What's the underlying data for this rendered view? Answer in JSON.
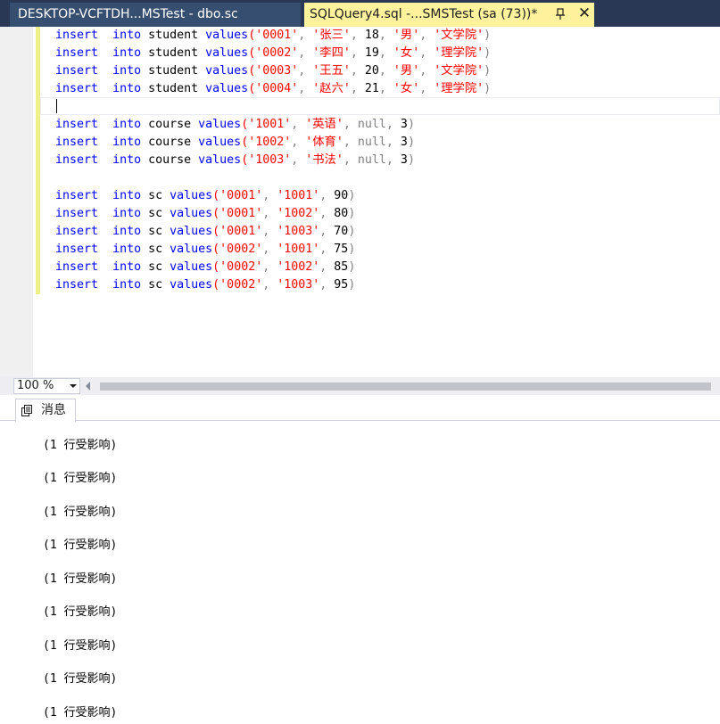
{
  "tabs": {
    "inactive_label": "DESKTOP-VCFTDH...MSTest - dbo.sc",
    "active_label": "SQLQuery4.sql -...SMSTest (sa (73))*",
    "close_glyph": "✕"
  },
  "code": {
    "lines": [
      [
        [
          "kw",
          "insert"
        ],
        [
          "",
          "  "
        ],
        [
          "kw",
          "into"
        ],
        [
          "",
          " student "
        ],
        [
          "kw",
          "values"
        ],
        [
          "str",
          "('0001'"
        ],
        [
          "gry",
          ", "
        ],
        [
          "str",
          "'张三'"
        ],
        [
          "gry",
          ", "
        ],
        [
          "",
          "18"
        ],
        [
          "gry",
          ", "
        ],
        [
          "str",
          "'男'"
        ],
        [
          "gry",
          ", "
        ],
        [
          "str",
          "'文学院'"
        ],
        [
          "gry",
          ")"
        ]
      ],
      [
        [
          "kw",
          "insert"
        ],
        [
          "",
          "  "
        ],
        [
          "kw",
          "into"
        ],
        [
          "",
          " student "
        ],
        [
          "kw",
          "values"
        ],
        [
          "str",
          "('0002'"
        ],
        [
          "gry",
          ", "
        ],
        [
          "str",
          "'李四'"
        ],
        [
          "gry",
          ", "
        ],
        [
          "",
          "19"
        ],
        [
          "gry",
          ", "
        ],
        [
          "str",
          "'女'"
        ],
        [
          "gry",
          ", "
        ],
        [
          "str",
          "'理学院'"
        ],
        [
          "gry",
          ")"
        ]
      ],
      [
        [
          "kw",
          "insert"
        ],
        [
          "",
          "  "
        ],
        [
          "kw",
          "into"
        ],
        [
          "",
          " student "
        ],
        [
          "kw",
          "values"
        ],
        [
          "str",
          "('0003'"
        ],
        [
          "gry",
          ", "
        ],
        [
          "str",
          "'王五'"
        ],
        [
          "gry",
          ", "
        ],
        [
          "",
          "20"
        ],
        [
          "gry",
          ", "
        ],
        [
          "str",
          "'男'"
        ],
        [
          "gry",
          ", "
        ],
        [
          "str",
          "'文学院'"
        ],
        [
          "gry",
          ")"
        ]
      ],
      [
        [
          "kw",
          "insert"
        ],
        [
          "",
          "  "
        ],
        [
          "kw",
          "into"
        ],
        [
          "",
          " student "
        ],
        [
          "kw",
          "values"
        ],
        [
          "str",
          "('0004'"
        ],
        [
          "gry",
          ", "
        ],
        [
          "str",
          "'赵六'"
        ],
        [
          "gry",
          ", "
        ],
        [
          "",
          "21"
        ],
        [
          "gry",
          ", "
        ],
        [
          "str",
          "'女'"
        ],
        [
          "gry",
          ", "
        ],
        [
          "str",
          "'理学院'"
        ],
        [
          "gry",
          ")"
        ]
      ],
      [],
      [
        [
          "kw",
          "insert"
        ],
        [
          "",
          "  "
        ],
        [
          "kw",
          "into"
        ],
        [
          "",
          " course "
        ],
        [
          "kw",
          "values"
        ],
        [
          "str",
          "('1001'"
        ],
        [
          "gry",
          ", "
        ],
        [
          "str",
          "'英语'"
        ],
        [
          "gry",
          ", "
        ],
        [
          "nul",
          "null"
        ],
        [
          "gry",
          ", "
        ],
        [
          "",
          "3"
        ],
        [
          "gry",
          ")"
        ]
      ],
      [
        [
          "kw",
          "insert"
        ],
        [
          "",
          "  "
        ],
        [
          "kw",
          "into"
        ],
        [
          "",
          " course "
        ],
        [
          "kw",
          "values"
        ],
        [
          "str",
          "('1002'"
        ],
        [
          "gry",
          ", "
        ],
        [
          "str",
          "'体育'"
        ],
        [
          "gry",
          ", "
        ],
        [
          "nul",
          "null"
        ],
        [
          "gry",
          ", "
        ],
        [
          "",
          "3"
        ],
        [
          "gry",
          ")"
        ]
      ],
      [
        [
          "kw",
          "insert"
        ],
        [
          "",
          "  "
        ],
        [
          "kw",
          "into"
        ],
        [
          "",
          " course "
        ],
        [
          "kw",
          "values"
        ],
        [
          "str",
          "('1003'"
        ],
        [
          "gry",
          ", "
        ],
        [
          "str",
          "'书法'"
        ],
        [
          "gry",
          ", "
        ],
        [
          "nul",
          "null"
        ],
        [
          "gry",
          ", "
        ],
        [
          "",
          "3"
        ],
        [
          "gry",
          ")"
        ]
      ],
      [],
      [
        [
          "kw",
          "insert"
        ],
        [
          "",
          "  "
        ],
        [
          "kw",
          "into"
        ],
        [
          "",
          " sc "
        ],
        [
          "kw",
          "values"
        ],
        [
          "str",
          "('0001'"
        ],
        [
          "gry",
          ", "
        ],
        [
          "str",
          "'1001'"
        ],
        [
          "gry",
          ", "
        ],
        [
          "",
          "90"
        ],
        [
          "gry",
          ")"
        ]
      ],
      [
        [
          "kw",
          "insert"
        ],
        [
          "",
          "  "
        ],
        [
          "kw",
          "into"
        ],
        [
          "",
          " sc "
        ],
        [
          "kw",
          "values"
        ],
        [
          "str",
          "('0001'"
        ],
        [
          "gry",
          ", "
        ],
        [
          "str",
          "'1002'"
        ],
        [
          "gry",
          ", "
        ],
        [
          "",
          "80"
        ],
        [
          "gry",
          ")"
        ]
      ],
      [
        [
          "kw",
          "insert"
        ],
        [
          "",
          "  "
        ],
        [
          "kw",
          "into"
        ],
        [
          "",
          " sc "
        ],
        [
          "kw",
          "values"
        ],
        [
          "str",
          "('0001'"
        ],
        [
          "gry",
          ", "
        ],
        [
          "str",
          "'1003'"
        ],
        [
          "gry",
          ", "
        ],
        [
          "",
          "70"
        ],
        [
          "gry",
          ")"
        ]
      ],
      [
        [
          "kw",
          "insert"
        ],
        [
          "",
          "  "
        ],
        [
          "kw",
          "into"
        ],
        [
          "",
          " sc "
        ],
        [
          "kw",
          "values"
        ],
        [
          "str",
          "('0002'"
        ],
        [
          "gry",
          ", "
        ],
        [
          "str",
          "'1001'"
        ],
        [
          "gry",
          ", "
        ],
        [
          "",
          "75"
        ],
        [
          "gry",
          ")"
        ]
      ],
      [
        [
          "kw",
          "insert"
        ],
        [
          "",
          "  "
        ],
        [
          "kw",
          "into"
        ],
        [
          "",
          " sc "
        ],
        [
          "kw",
          "values"
        ],
        [
          "str",
          "('0002'"
        ],
        [
          "gry",
          ", "
        ],
        [
          "str",
          "'1002'"
        ],
        [
          "gry",
          ", "
        ],
        [
          "",
          "85"
        ],
        [
          "gry",
          ")"
        ]
      ],
      [
        [
          "kw",
          "insert"
        ],
        [
          "",
          "  "
        ],
        [
          "kw",
          "into"
        ],
        [
          "",
          " sc "
        ],
        [
          "kw",
          "values"
        ],
        [
          "str",
          "('0002'"
        ],
        [
          "gry",
          ", "
        ],
        [
          "str",
          "'1003'"
        ],
        [
          "gry",
          ", "
        ],
        [
          "",
          "95"
        ],
        [
          "gry",
          ")"
        ]
      ]
    ]
  },
  "zoom": {
    "value": "100 %"
  },
  "results": {
    "tab_label": "消息",
    "messages": [
      "(1 行受影响)",
      "(1 行受影响)",
      "(1 行受影响)",
      "(1 行受影响)",
      "(1 行受影响)",
      "(1 行受影响)",
      "(1 行受影响)",
      "(1 行受影响)",
      "(1 行受影响)"
    ]
  },
  "colors": {
    "keyword": "#0000ff",
    "string": "#ff0000",
    "null": "#808080",
    "active_tab": "#fff29d",
    "tab_strip": "#293955"
  }
}
